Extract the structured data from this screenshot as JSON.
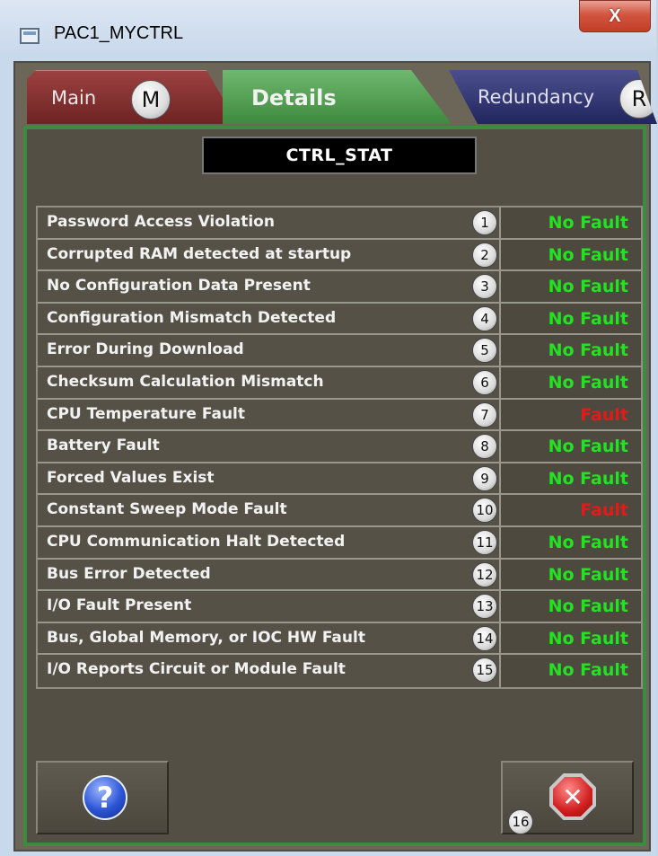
{
  "window": {
    "title": "PAC1_MYCTRL",
    "close_glyph": "X"
  },
  "tabs": [
    {
      "label": "Main",
      "key": "M"
    },
    {
      "label": "Details",
      "key": ""
    },
    {
      "label": "Redundancy",
      "key": "R"
    }
  ],
  "active_tab": "Details",
  "header": {
    "label": "CTRL_STAT"
  },
  "faults": [
    {
      "label": "Password Access Violation",
      "num": "1",
      "status": "No Fault"
    },
    {
      "label": "Corrupted RAM detected at startup",
      "num": "2",
      "status": "No Fault"
    },
    {
      "label": "No Configuration Data Present",
      "num": "3",
      "status": "No Fault"
    },
    {
      "label": "Configuration Mismatch Detected",
      "num": "4",
      "status": "No Fault"
    },
    {
      "label": "Error During Download",
      "num": "5",
      "status": "No Fault"
    },
    {
      "label": "Checksum Calculation Mismatch",
      "num": "6",
      "status": "No Fault"
    },
    {
      "label": "CPU Temperature Fault",
      "num": "7",
      "status": "Fault"
    },
    {
      "label": "Battery Fault",
      "num": "8",
      "status": "No Fault"
    },
    {
      "label": "Forced Values Exist",
      "num": "9",
      "status": "No Fault"
    },
    {
      "label": "Constant Sweep Mode Fault",
      "num": "10",
      "status": "Fault"
    },
    {
      "label": "CPU Communication Halt Detected",
      "num": "11",
      "status": "No Fault"
    },
    {
      "label": "Bus Error Detected",
      "num": "12",
      "status": "No Fault"
    },
    {
      "label": "I/O Fault Present",
      "num": "13",
      "status": "No Fault"
    },
    {
      "label": "Bus, Global Memory, or IOC HW Fault",
      "num": "14",
      "status": "No Fault"
    },
    {
      "label": "I/O Reports Circuit or Module Fault",
      "num": "15",
      "status": "No Fault"
    }
  ],
  "buttons": {
    "help": {
      "glyph": "?",
      "icon": "help-icon"
    },
    "close": {
      "glyph": "✕",
      "icon": "close-icon",
      "num": "16"
    }
  },
  "colors": {
    "no_fault": "#22e322",
    "fault": "#e31a1a",
    "details_tab": "#3e8a3e",
    "main_tab": "#7a2a2a",
    "redundancy_tab": "#2a2f6b"
  }
}
